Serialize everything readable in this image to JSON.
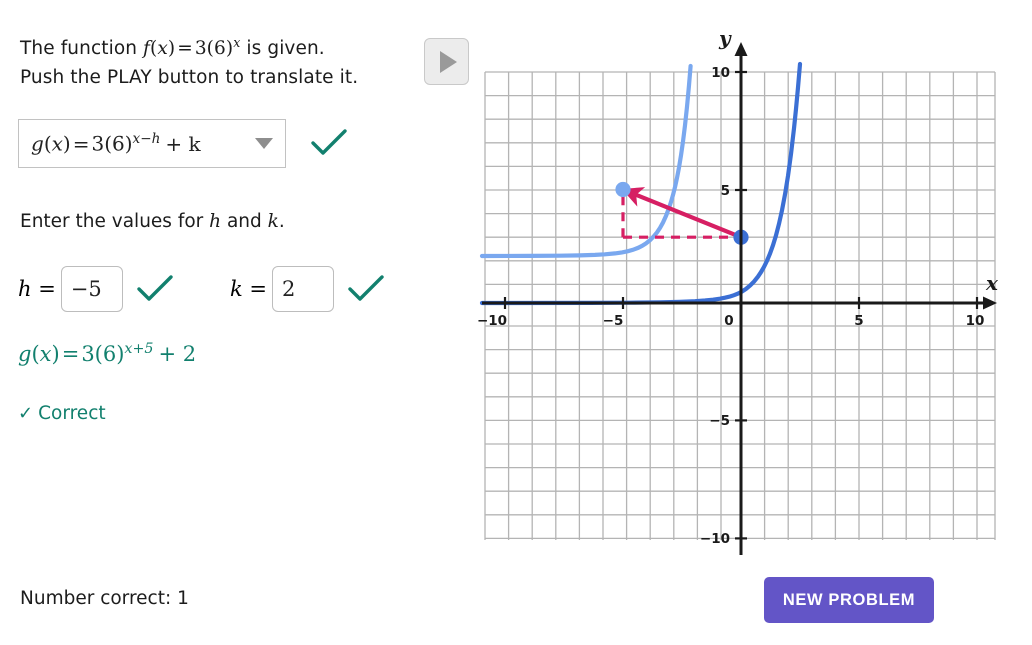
{
  "prompt": {
    "line1_pre": "The function ",
    "line1_fn": "f",
    "line1_paren_open": "(",
    "line1_var": "x",
    "line1_paren_close": ")",
    "line1_eq": "=",
    "line1_coef": "3(6)",
    "line1_exp": "x",
    "line1_post": " is given.",
    "line2": "Push the PLAY button to translate it."
  },
  "play_button": {
    "name": "PLAY",
    "icon": "play-triangle-icon"
  },
  "dropdown": {
    "selected": "g(x) = 3(6)^(x-h) + k",
    "fn": "g",
    "var": "x",
    "eq": "=",
    "coef": "3(6)",
    "exp": "x−h",
    "tail": "+ k",
    "caret_icon": "chevron-down-icon",
    "validated": true
  },
  "instruction": {
    "pre": "Enter the values for ",
    "h": "h",
    "mid": " and ",
    "k": "k",
    "post": "."
  },
  "inputs": {
    "h": {
      "label": "h =",
      "value": "−5",
      "correct": true,
      "check_icon": "check-icon"
    },
    "k": {
      "label": "k =",
      "value": "2",
      "correct": true,
      "check_icon": "check-icon"
    }
  },
  "answer": {
    "fn": "g",
    "var": "x",
    "eq": "=",
    "coef": "3(6)",
    "exp": "x+5",
    "tail": "+ 2",
    "full": "g(x) = 3(6)^(x+5) + 2"
  },
  "verdict": {
    "tick": "✓",
    "text": "Correct"
  },
  "score": {
    "text": "Number correct: 1",
    "label": "Number correct:",
    "value": "1"
  },
  "new_problem_button": {
    "label": "NEW PROBLEM"
  },
  "colors": {
    "accent_purple": "#6355c7",
    "correct_teal": "#12806e",
    "curve_original": "#3b6fd4",
    "curve_translated": "#7aa8ef",
    "vector_pink": "#d61f63",
    "grid": "#b4b4b4",
    "axis": "#1a1a1a"
  },
  "chart_data": {
    "type": "line",
    "title": "",
    "xlabel": "x",
    "ylabel": "y",
    "xlim": [
      -11,
      11
    ],
    "ylim": [
      -11.5,
      11
    ],
    "xticks": [
      -10,
      -5,
      0,
      5,
      10
    ],
    "yticks": [
      10,
      5,
      -5,
      -10
    ],
    "xtick_labels": [
      "−10",
      "−5",
      "0",
      "5",
      "10"
    ],
    "ytick_labels": [
      "10",
      "5",
      "−5",
      "−10"
    ],
    "grid": true,
    "grid_step": 1,
    "major_grid_step": 1,
    "series": [
      {
        "name": "f(x) = 3(6)^x",
        "expression": "3*pow(6,x)",
        "color": "#3b6fd4",
        "asymptote": 0,
        "style": "solid"
      },
      {
        "name": "g(x) = 3(6)^(x+5) + 2",
        "expression": "3*pow(6,x+5)+2",
        "color": "#7aa8ef",
        "asymptote": 2,
        "style": "solid"
      }
    ],
    "points": [
      {
        "name": "source-point",
        "x": 0,
        "y": 3,
        "color": "#3b6fd4"
      },
      {
        "name": "image-point",
        "x": -5,
        "y": 5,
        "color": "#7aa8ef"
      }
    ],
    "vector": {
      "name": "translation-vector",
      "from": [
        0,
        3
      ],
      "to": [
        -5,
        5
      ],
      "color": "#d61f63",
      "arrow": true
    },
    "dashed_legs": {
      "color": "#d61f63",
      "horizontal": {
        "from": [
          -5,
          3
        ],
        "to": [
          0,
          3
        ]
      },
      "vertical": {
        "from": [
          -5,
          3
        ],
        "to": [
          -5,
          5
        ]
      }
    }
  }
}
